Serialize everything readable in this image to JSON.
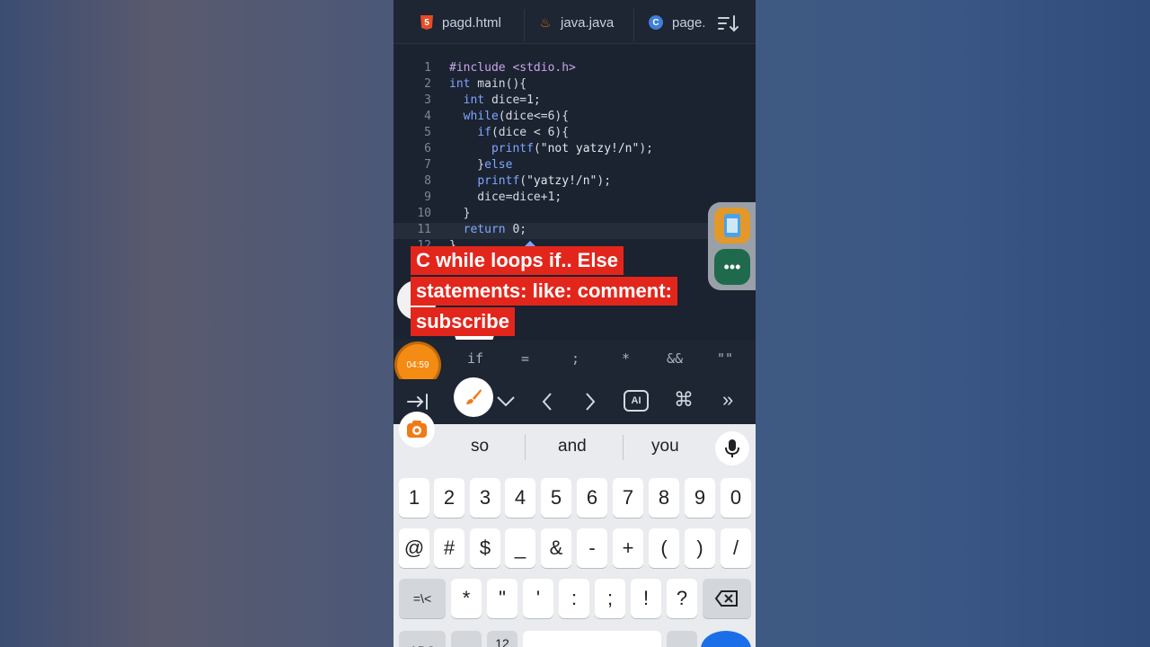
{
  "tabs": [
    {
      "label": "pagd.html",
      "icon": "html5-icon"
    },
    {
      "label": "java.java",
      "icon": "java-icon"
    },
    {
      "label": "page.c",
      "icon": "c-language-icon"
    }
  ],
  "code": {
    "line_numbers": [
      "1",
      "2",
      "3",
      "4",
      "5",
      "6",
      "7",
      "8",
      "9",
      "10",
      "11",
      "12"
    ],
    "lines": [
      "#include <stdio.h>",
      "int main(){",
      "  int dice=1;",
      "  while(dice<=6){",
      "    if(dice < 6){",
      "      printf(\"not yatzy!/n\");",
      "    }else",
      "    printf(\"yatzy!/n\");",
      "    dice=dice+1;",
      "  }",
      "  return 0;",
      "}"
    ],
    "current_line": 11
  },
  "caption": {
    "line1": "C while loops if.. Else",
    "line2": "statements: like: comment:",
    "line3": "subscribe"
  },
  "timer": "04:59",
  "symbols": [
    "if",
    "=",
    ";",
    "*",
    "&&",
    "\"\""
  ],
  "suggestions": [
    "so",
    "and",
    "you"
  ],
  "keys": {
    "row1": [
      "1",
      "2",
      "3",
      "4",
      "5",
      "6",
      "7",
      "8",
      "9",
      "0"
    ],
    "row2": [
      "@",
      "#",
      "$",
      "_",
      "&",
      "-",
      "+",
      "(",
      ")",
      "/"
    ],
    "row3_mode": "=\\<",
    "row3": [
      "*",
      "\"",
      "'",
      ":",
      ";",
      "!",
      "?"
    ],
    "row4_left": "ABC",
    "row4_num": "12"
  },
  "colors": {
    "editor_bg": "#1b2230",
    "caption_bg": "#e3261c",
    "timer_bg": "#f48b12",
    "keyboard_bg": "#e9ebee",
    "send_button": "#1a6fe8"
  }
}
